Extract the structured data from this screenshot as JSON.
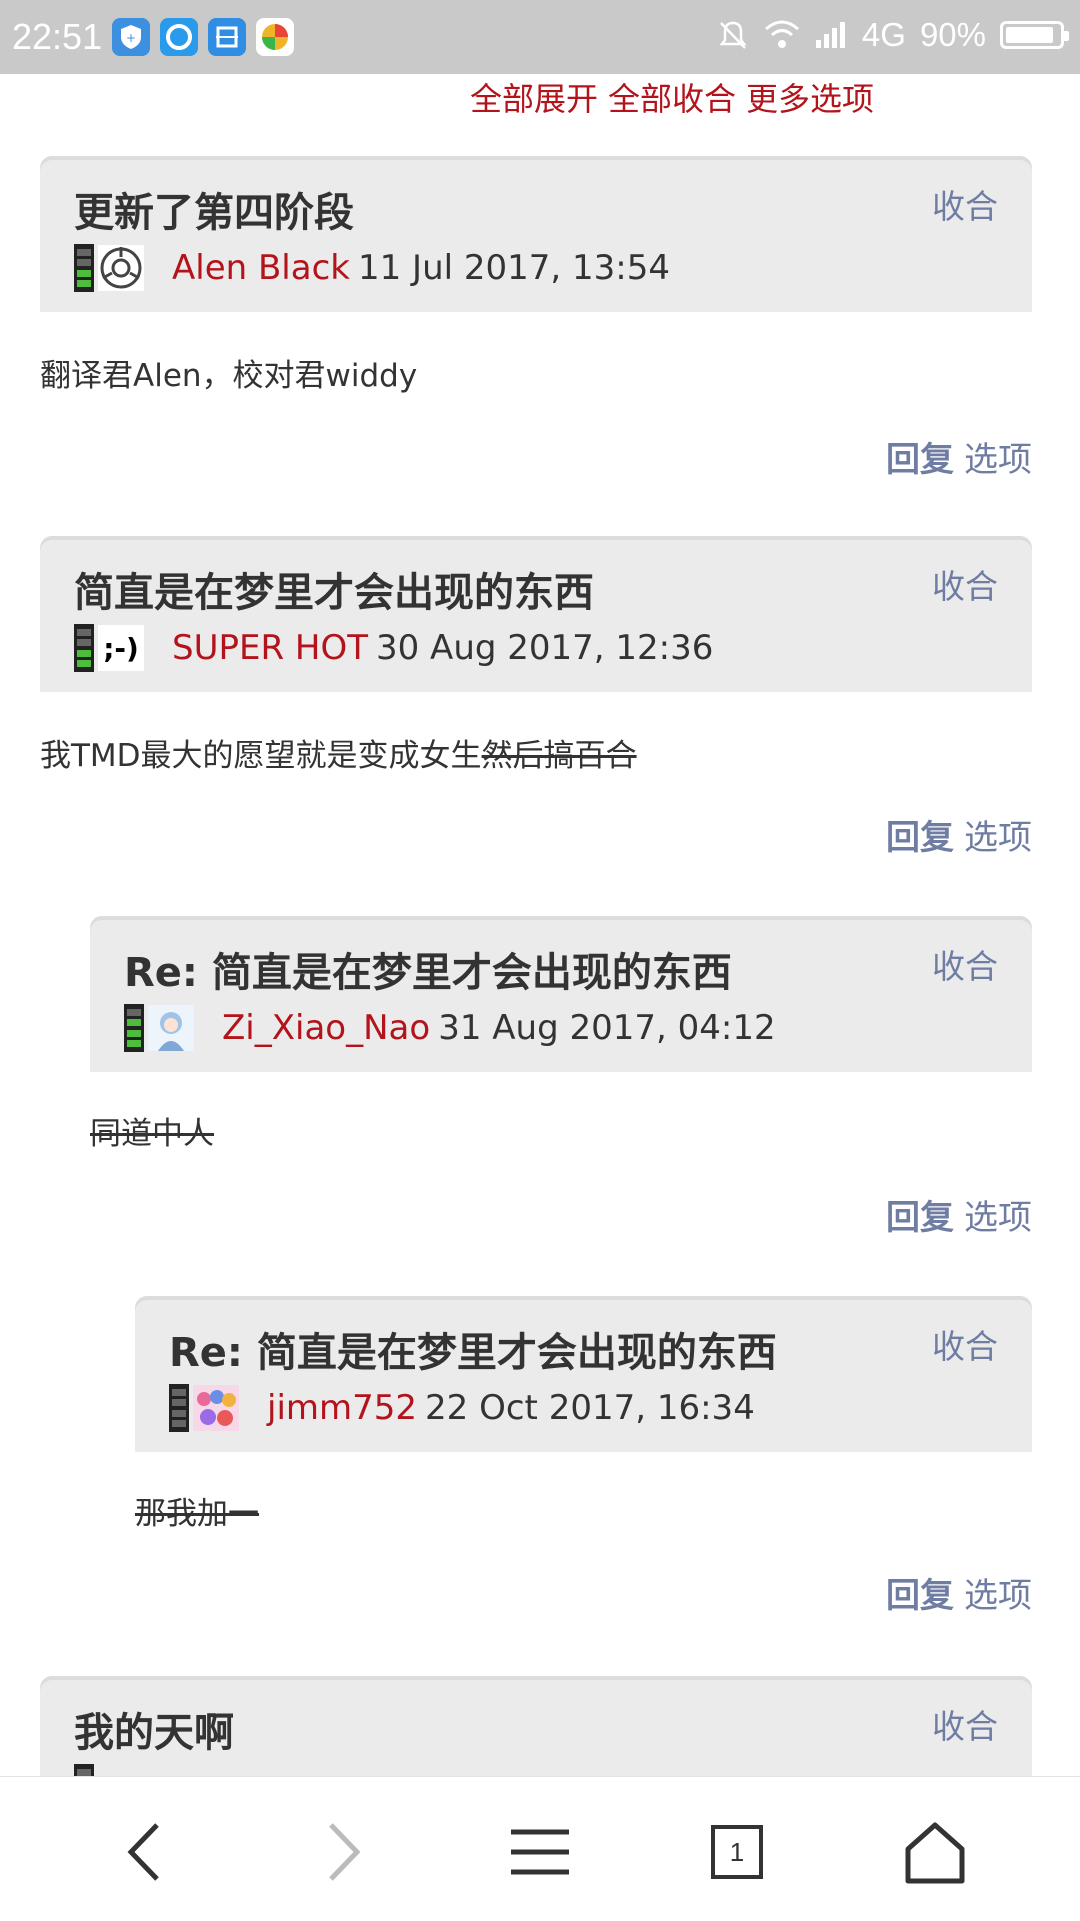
{
  "status_bar": {
    "time": "22:51",
    "network": "4G",
    "battery": "90%",
    "battery_level": 0.9,
    "icons": [
      "shield-app-icon",
      "circle-app-icon",
      "scan-app-icon",
      "browser-app-icon",
      "mute-icon",
      "wifi-icon",
      "signal-icon",
      "battery-icon"
    ]
  },
  "top_links": {
    "expand_all": "全部展开",
    "collapse_all": "全部收合",
    "more_options": "更多选项"
  },
  "posts": [
    {
      "title": "更新了第四阶段",
      "collapse_label": "收合",
      "author": "Alen Black",
      "date": "11 Jul 2017, 13:54",
      "avatar_icon": "scp-logo-icon",
      "content": "翻译君Alen，校对君widdy",
      "reply_label": "回复",
      "options_label": "选项"
    },
    {
      "title": "简直是在梦里才会出现的东西",
      "collapse_label": "收合",
      "author": "SUPER HOT",
      "date": "30 Aug 2017, 12:36",
      "avatar_icon": "wink-face-icon",
      "avatar_text": ";-)",
      "content_plain": "我TMD最大的愿望就是变成女生",
      "content_struck": "然后搞百合",
      "reply_label": "回复",
      "options_label": "选项"
    },
    {
      "title": "Re: 简直是在梦里才会出现的东西",
      "collapse_label": "收合",
      "author": "Zi_Xiao_Nao",
      "date": "31 Aug 2017, 04:12",
      "avatar_icon": "anime-girl-avatar-icon",
      "content_struck": "同道中人",
      "reply_label": "回复",
      "options_label": "选项"
    },
    {
      "title": "Re: 简直是在梦里才会出现的东西",
      "collapse_label": "收合",
      "author": "jimm752",
      "date": "22 Oct 2017, 16:34",
      "avatar_icon": "group-avatar-icon",
      "content_struck": "那我加一",
      "reply_label": "回复",
      "options_label": "选项"
    },
    {
      "title": "我的天啊",
      "collapse_label": "收合"
    }
  ],
  "bottom_nav": {
    "tab_count": "1",
    "buttons": [
      "back-arrow-icon",
      "forward-arrow-icon",
      "menu-icon",
      "tabs-icon",
      "home-icon"
    ]
  },
  "colors": {
    "author": "#b3131b",
    "action": "#6f7da3",
    "header_bg": "#ebebeb",
    "rank_green": "#4fbd3c"
  }
}
